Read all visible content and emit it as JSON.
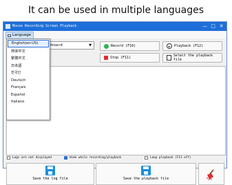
{
  "caption": "It can be used in multiple languages",
  "window": {
    "title": "Mouse Recording Screen Playback",
    "controls": {
      "minimize": "—",
      "maximize": "□",
      "close": "✕"
    }
  },
  "menu": {
    "language_label": "Language"
  },
  "language_options": [
    "English(en-US)",
    "简体中文",
    "繁體中文",
    "日本語",
    "한국인",
    "Deutsch",
    "Français",
    "Español",
    "Italiano"
  ],
  "selected_language": "English(en-US)",
  "input_combo": {
    "value": "yboard",
    "arrow": "▼"
  },
  "buttons": {
    "record": "Record (F10)",
    "playback": "Playback (F12)",
    "stop": "Stop (F11)",
    "select_file": "Select the playback file",
    "save_log": "Save the log file",
    "save_playback": "Save the playback file"
  },
  "checkboxes": {
    "logs_not_displayed": {
      "label": "Logs are not displayed",
      "checked": false
    },
    "hide_while_recording": {
      "label": "Hide while recording/playback",
      "checked": true
    },
    "loop_playback": {
      "label": "Loop playback (F11 off)",
      "checked": false
    }
  },
  "colors": {
    "titlebar": "#1e6fd9",
    "record": "#2db35a",
    "stop": "#e03030",
    "save": "#1a8fd8"
  }
}
